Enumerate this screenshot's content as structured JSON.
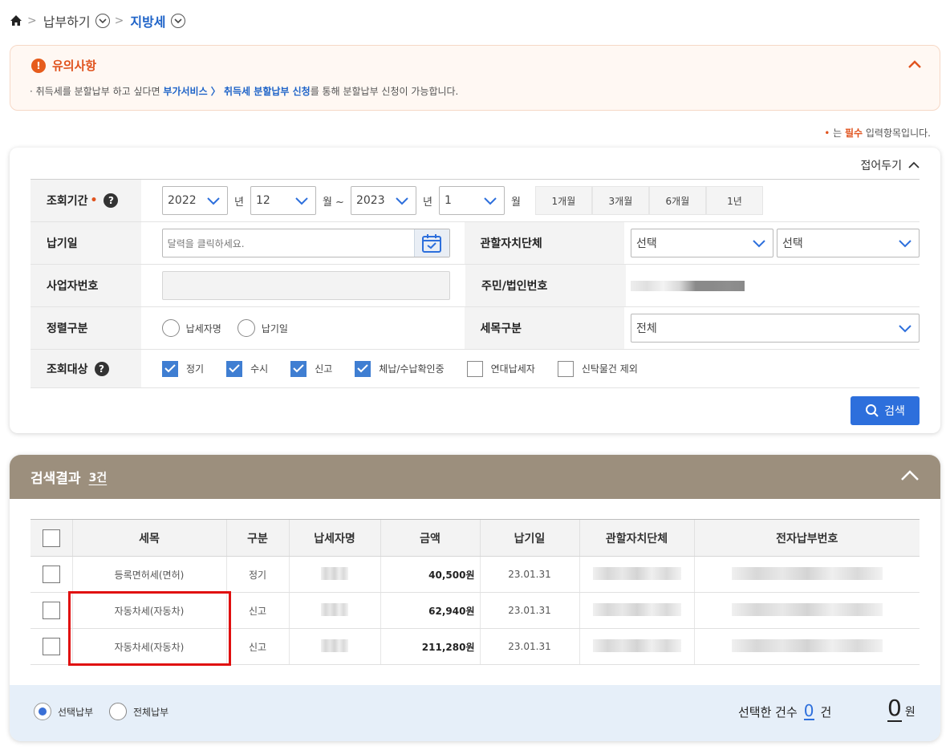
{
  "breadcrumb": {
    "level1": "납부하기",
    "level2": "지방세"
  },
  "notice": {
    "title": "유의사항",
    "text_pre": "· 취득세를 분할납부 하고 싶다면 ",
    "text_link": "부가서비스 〉 취득세 분할납부 신청",
    "text_post": "를 통해 분할납부 신청이 가능합니다."
  },
  "required_note": {
    "pre": "는 ",
    "word": "필수",
    "post": " 입력항목입니다."
  },
  "search": {
    "fold_label": "접어두기",
    "period": {
      "label": "조회기간",
      "from_year": "2022",
      "from_month": "12",
      "to_year": "2023",
      "to_month": "1",
      "unit_year": "년",
      "unit_month_from": "월 ~",
      "unit_month": "월",
      "quick": [
        "1개월",
        "3개월",
        "6개월",
        "1년"
      ]
    },
    "due_date": {
      "label": "납기일",
      "placeholder": "달력을 클릭하세요."
    },
    "jurisdiction": {
      "label": "관할자치단체",
      "select1": "선택",
      "select2": "선택"
    },
    "business_no": {
      "label": "사업자번호"
    },
    "resident_no": {
      "label": "주민/법인번호"
    },
    "sort": {
      "label": "정렬구분",
      "options": [
        "납세자명",
        "납기일"
      ]
    },
    "tax_item": {
      "label": "세목구분",
      "value": "전체"
    },
    "target": {
      "label": "조회대상",
      "options": [
        {
          "label": "정기",
          "checked": true
        },
        {
          "label": "수시",
          "checked": true
        },
        {
          "label": "신고",
          "checked": true
        },
        {
          "label": "체납/수납확인중",
          "checked": true
        },
        {
          "label": "연대납세자",
          "checked": false
        },
        {
          "label": "신탁물건 제외",
          "checked": false
        }
      ]
    },
    "search_button": "검색"
  },
  "results": {
    "title": "검색결과",
    "count": "3건",
    "columns": [
      "세목",
      "구분",
      "납세자명",
      "금액",
      "납기일",
      "관할자치단체",
      "전자납부번호"
    ],
    "rows": [
      {
        "item": "등록면허세(면허)",
        "type": "정기",
        "amount": "40,500원",
        "due": "23.01.31"
      },
      {
        "item": "자동차세(자동차)",
        "type": "신고",
        "amount": "62,940원",
        "due": "23.01.31"
      },
      {
        "item": "자동차세(자동차)",
        "type": "신고",
        "amount": "211,280원",
        "due": "23.01.31"
      }
    ]
  },
  "footer": {
    "pay_selected": "선택납부",
    "pay_all": "전체납부",
    "selected_count_label": "선택한 건수",
    "selected_count": "0",
    "count_unit": "건",
    "total": "0",
    "total_unit": "원"
  },
  "colors": {
    "accent": "#2d6fdc",
    "notice": "#e0531e",
    "result_header": "#9c8f7d"
  }
}
